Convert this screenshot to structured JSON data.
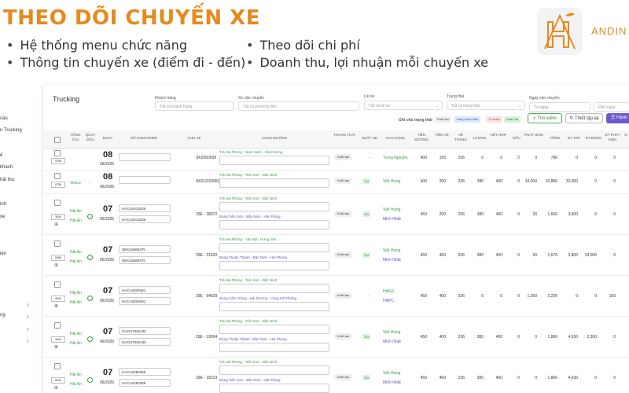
{
  "slide": {
    "title": "THEO DÕI CHUYẾN XE",
    "bullets_left": [
      "Hệ thống menu chức năng",
      "Thông tin chuyến xe (điểm đi - đến)"
    ],
    "bullets_right": [
      "Theo dõi chi phí",
      "Doanh thu, lợi nhuận mỗi chuyến xe"
    ],
    "brand": "ANDIN"
  },
  "sidebar": {
    "items": [
      "",
      "cầu",
      "n Trucking",
      "",
      "ế",
      "khách",
      "hải thu",
      "",
      "inh",
      "xe",
      "",
      "",
      "iện",
      "",
      "",
      "",
      "",
      "",
      "ng",
      "",
      ""
    ]
  },
  "panel": {
    "title": "Trucking",
    "filters": {
      "customer_label": "Khách hàng",
      "customer_placeholder": "Tất cả khách hàng",
      "route_label": "Xe vận chuyển",
      "route_placeholder": "Tất cả phương tiện",
      "driver_label": "Lái xe",
      "driver_placeholder": "Tất cả lái xe",
      "status_label": "Trạng thái",
      "status_placeholder": "Tất cả trạng thái",
      "date_label": "Ngày vận chuyển",
      "date_from": "Từ ngày",
      "date_to": "Đến ngày"
    },
    "chips_label": "Ghi chú trạng thái",
    "chips": [
      {
        "label": "Khởi tạo",
        "bg": "#eeeeee",
        "color": "#444"
      },
      {
        "label": "Đang thực hiện",
        "bg": "#dbe8ff",
        "color": "#2a5db0"
      },
      {
        "label": "Trì hoãn",
        "bg": "#fde0e0",
        "color": "#c0392b"
      },
      {
        "label": "Hoàn tất",
        "bg": "#d9f2dc",
        "color": "#2e7d32"
      }
    ],
    "btn_search": "Tìm kiếm",
    "btn_reset": "Thiết lập lại",
    "btn_action": "Hành"
  },
  "columns": [
    "HÃNG TÀU",
    "QUAY ĐẦU",
    "NGÀY",
    "SỐ CONTAINER",
    "CHỦ XE",
    "CUNG ĐƯỜNG",
    "TRẠNG THÁI",
    "XUẤT HĐ",
    "CHỦ HÀNG",
    "TIỀN ĐƯỜNG",
    "TIỀN VÉ",
    "VÉ THÁNG",
    "LƯƠNG",
    "KẾT HỢP",
    "DẦU",
    "PHÁT SINH",
    "TỔNG",
    "DT TRẢ",
    "DT ĐÓNG",
    "DT PHÁT SINH",
    "D T"
  ],
  "rows": [
    {
      "id": "9785",
      "line1": "",
      "line2": "",
      "turn": "",
      "day": "08",
      "date": "06/2026",
      "cont1": "",
      "cont2": "",
      "owner": "SK2050039",
      "route1": "Trà Hải Phòng - Nam Sách - Hải Dương",
      "route2": "",
      "status": "Khởi tạo",
      "invoice": "-",
      "shipper1": "Trung Nguyên",
      "shipper2": "",
      "road": "400",
      "ticket": "150",
      "monthly": "236",
      "salary": "0",
      "combo": "0",
      "oil": "0",
      "extra": "0",
      "total": "786",
      "dt_tra": "0",
      "dt_dong": "0",
      "dt_ps": "0",
      "dt": ""
    },
    {
      "id": "9786",
      "line1": "Vosco",
      "line2": "",
      "turn": "-",
      "day": "08",
      "date": "06/2026",
      "cont1": "",
      "cont2": "",
      "owner": "SK0120209029029",
      "route1": "Trà Hải Phòng - Tiên Sơn - Bắc Ninh",
      "route2": "",
      "status": "Khởi tạo",
      "invoice": "Trừ",
      "shipper1": "Việt Hưng",
      "shipper2": "",
      "road": "400",
      "ticket": "200",
      "monthly": "236",
      "salary": "380",
      "combo": "400",
      "oil": "0",
      "extra": "10,000",
      "total": "10,886",
      "dt_tra": "20,000",
      "dt_dong": "0",
      "dt_ps": "0",
      "dt": ""
    },
    {
      "id": "3830",
      "line1": "Hải An",
      "line2": "Hải An",
      "turn": "ok",
      "day": "07",
      "date": "06/2026",
      "cont1": "HACU4013035",
      "cont2": "HACU4013035",
      "owner": "29E - 38072",
      "route1": "Trà Hải Phòng - Tiên Sơn - Bắc Ninh",
      "route2": "Đóng Tiên Sơn - Bắc Ninh - Hải Phòng",
      "status": "Khởi tạo",
      "invoice": "Trừ",
      "shipper1": "Việt Hưng",
      "shipper2": "Minh Nhất",
      "road": "450",
      "ticket": "200",
      "monthly": "236",
      "salary": "380",
      "combo": "400",
      "oil": "0",
      "extra": "30",
      "total": "1,666",
      "dt_tra": "3,600",
      "dt_dong": "0",
      "dt_ps": "0",
      "dt": ""
    },
    {
      "id": "5588",
      "line1": "Hải An",
      "line2": "Hải An",
      "turn": "ok",
      "day": "07",
      "date": "06/2026",
      "cont1": "SEKU6569375",
      "cont2": "SEKU6569375",
      "owner": "29E - 21620",
      "route1": "Trà Hải Phòng - Yên Mỹ - Hưng Yên",
      "route2": "Đóng Thuận Thành - Bắc Ninh - Hải Phòng",
      "status": "Khởi tạo",
      "invoice": "Trừ",
      "shipper1": "Việt Hưng",
      "shipper2": "Minh Nhất",
      "road": "450",
      "ticket": "400",
      "monthly": "236",
      "salary": "380",
      "combo": "400",
      "oil": "0",
      "extra": "30",
      "total": "1,676",
      "dt_tra": "3,800",
      "dt_dong": "24,000",
      "dt_ps": "0",
      "dt": ""
    },
    {
      "id": "9840",
      "line1": "Hải An",
      "line2": "Hải An",
      "turn": "ok",
      "day": "07",
      "date": "06/2026",
      "cont1": "HACU4029481",
      "cont2": "HACU4029481",
      "owner": "29E - 94529",
      "route1": "Trà Hải Phòng - Tiên Sơn - Bắc Ninh",
      "route2": "Đóng Cẩm Giàng - Hải Dương - Cảng Hải Phòng",
      "status": "Khởi tạo",
      "invoice": "-",
      "shipper1": "HAGS",
      "shipper2": "HAPC",
      "road": "450",
      "ticket": "400",
      "monthly": "236",
      "salary": "0",
      "combo": "0",
      "oil": "0",
      "extra": "1,360",
      "total": "3,226",
      "dt_tra": "0",
      "dt_dong": "0",
      "dt_ps": "100",
      "dt": ""
    },
    {
      "id": "3644",
      "line1": "Hải An",
      "line2": "Hải An",
      "turn": "ok",
      "day": "07",
      "date": "06/2026",
      "cont1": "GAOU7662435",
      "cont2": "GAOU7662435",
      "owner": "29E - 19504",
      "route1": "Trà Hải Phòng - Tiên Sơn - Bắc Ninh",
      "route2": "Đóng Thuận Thành / Bắc Ninh - Hải Phòng",
      "status": "Khởi tạo",
      "invoice": "Trừ",
      "shipper1": "Việt Hưng",
      "shipper2": "Minh Nhất",
      "road": "450",
      "ticket": "400",
      "monthly": "236",
      "salary": "380",
      "combo": "400",
      "oil": "0",
      "extra": "0",
      "total": "1,866",
      "dt_tra": "4,630",
      "dt_dong": "2,300",
      "dt_ps": "0",
      "dt": ""
    },
    {
      "id": "8543",
      "line1": "Hải An",
      "line2": "Hải An",
      "turn": "ok",
      "day": "07",
      "date": "06/2026",
      "cont1": "HACU4280356",
      "cont2": "HACU4280356",
      "owner": "29E - 18123",
      "route1": "Trà Hải Phòng - Tiên Sơn - Bắc Ninh",
      "route2": "Đóng Tiên Sơn - Bắc Ninh - Hải Phòng",
      "status": "Khởi tạo",
      "invoice": "Trừ",
      "shipper1": "Việt Hưng",
      "shipper2": "Minh Nhất",
      "road": "450",
      "ticket": "400",
      "monthly": "236",
      "salary": "380",
      "combo": "400",
      "oil": "0",
      "extra": "0",
      "total": "1,866",
      "dt_tra": "4,630",
      "dt_dong": "0",
      "dt_ps": "0",
      "dt": ""
    }
  ]
}
